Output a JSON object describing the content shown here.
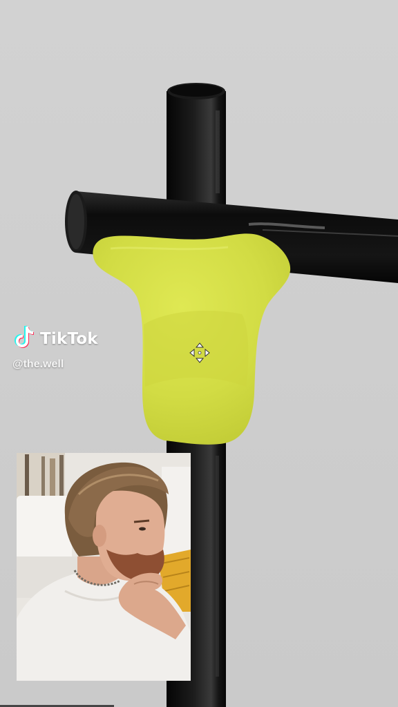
{
  "watermark": {
    "brand": "TikTok",
    "handle": "@the.well",
    "logo_icon": "tiktok-note-icon"
  },
  "editor": {
    "move_handle_icon": "move-arrows-icon"
  },
  "video_overlay": {
    "description": "picture-in-picture presenter camera"
  },
  "colors": {
    "background": "#cfcfcf",
    "pipe": "#111111",
    "blob": "#d7e14a",
    "watermark_text": "#ffffff"
  }
}
